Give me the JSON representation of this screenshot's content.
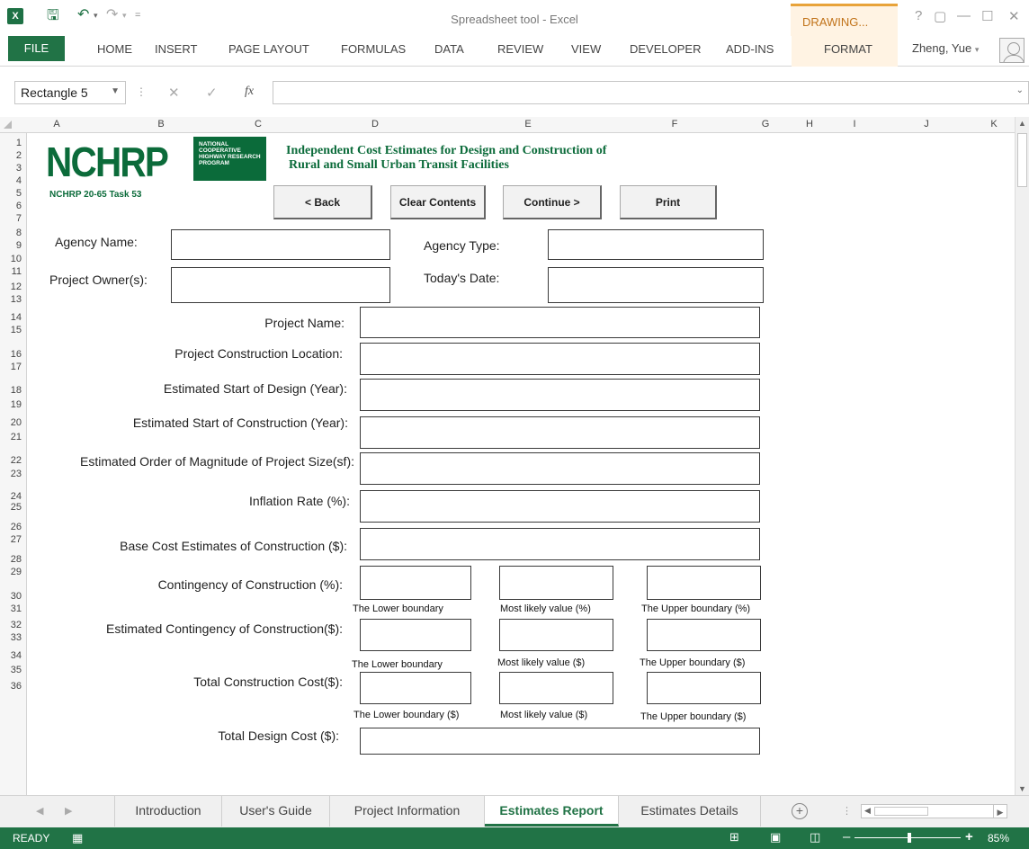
{
  "window": {
    "title": "Spreadsheet tool - Excel",
    "contextual_tab_group": "DRAWING...",
    "help": "?",
    "restore": "▢",
    "minimize": "—",
    "maximize": "☐",
    "close": "✕"
  },
  "ribbon": {
    "tabs": [
      "FILE",
      "HOME",
      "INSERT",
      "PAGE LAYOUT",
      "FORMULAS",
      "DATA",
      "REVIEW",
      "VIEW",
      "DEVELOPER",
      "ADD-INS",
      "FORMAT"
    ],
    "user": "Zheng, Yue"
  },
  "formula_bar": {
    "name_box": "Rectangle 5",
    "fx": "fx",
    "formula_value": ""
  },
  "grid": {
    "columns": [
      "A",
      "B",
      "C",
      "D",
      "E",
      "F",
      "G",
      "H",
      "I",
      "J",
      "K"
    ],
    "rows": [
      "1",
      "2",
      "3",
      "4",
      "5",
      "6",
      "7",
      "8",
      "9",
      "10",
      "11",
      "12",
      "13",
      "14",
      "15",
      "16",
      "17",
      "18",
      "19",
      "20",
      "21",
      "22",
      "23",
      "24",
      "25",
      "26",
      "27",
      "28",
      "29",
      "30",
      "31",
      "32",
      "33",
      "34",
      "35",
      "36"
    ]
  },
  "header": {
    "logo_text": "NCHRP",
    "program_text": "NATIONAL COOPERATIVE HIGHWAY RESEARCH PROGRAM",
    "task": "NCHRP 20-65 Task 53",
    "title_line1": "Independent Cost Estimates for Design and Construction of",
    "title_line2": "Rural and Small Urban Transit Facilities"
  },
  "buttons": {
    "back": "< Back",
    "clear": "Clear Contents",
    "continue": "Continue >",
    "print": "Print"
  },
  "form": {
    "agency_name": "Agency Name:",
    "agency_type": "Agency Type:",
    "project_owner": "Project Owner(s):",
    "todays_date": "Today's Date:",
    "project_name": "Project Name:",
    "construction_location": "Project Construction Location:",
    "start_design": "Estimated Start of Design (Year):",
    "start_construction": "Estimated Start of Construction (Year):",
    "order_magnitude": "Estimated Order of Magnitude of Project Size(sf):",
    "inflation": "Inflation Rate (%):",
    "base_cost": "Base Cost Estimates of Construction ($):",
    "contingency_pct": "Contingency of Construction (%):",
    "contingency_est": "Estimated Contingency of Construction($):",
    "total_construction": "Total Construction Cost($):",
    "total_design": "Total Design Cost ($):",
    "pct_lower": "The Lower boundary",
    "pct_likely": "Most likely value (%)",
    "pct_upper": "The Upper boundary (%)",
    "usd_lower": "The Lower boundary",
    "usd_likely": "Most likely value ($)",
    "usd_upper": "The Upper boundary  ($)",
    "tot_lower": "The Lower boundary  ($)",
    "tot_likely": "Most likely value ($)",
    "tot_upper": "The Upper boundary  ($)"
  },
  "sheet_tabs": [
    "Introduction",
    "User's Guide",
    "Project Information",
    "Estimates Report",
    "Estimates Details"
  ],
  "status": {
    "ready": "READY",
    "zoom": "85%"
  }
}
